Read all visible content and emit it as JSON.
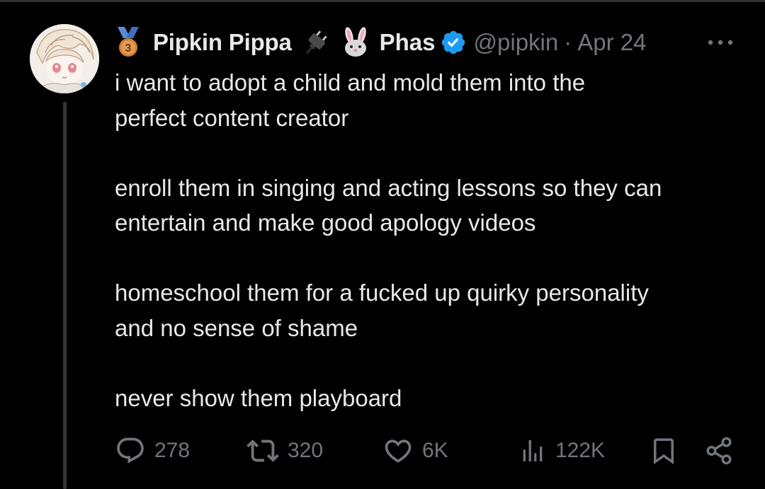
{
  "tweet": {
    "author": {
      "display_name": "Pipkin Pippa",
      "name_tail": "Phas",
      "handle": "@pipkin",
      "avatar": "avatar-anime-girl",
      "badges": [
        "medal-3-icon",
        "plug-icon",
        "rabbit-icon",
        "verified-badge-icon"
      ]
    },
    "separator": "·",
    "date": "Apr 24",
    "text": [
      "i want to adopt a child and mold them into the\nperfect content creator",
      "enroll them in singing and acting lessons so they can\nentertain and make good apology videos",
      "homeschool them for a fucked up quirky personality\nand no sense of shame",
      "never show them playboard"
    ],
    "actions": {
      "replies": "278",
      "retweets": "320",
      "likes": "6K",
      "views": "122K"
    }
  },
  "colors": {
    "background": "#000000",
    "text": "#e7e9ea",
    "secondary": "#71767b",
    "verified": "#1d9bf0",
    "medal": "#cd7f32"
  }
}
